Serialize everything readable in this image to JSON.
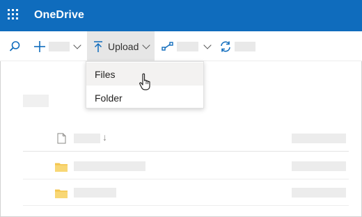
{
  "colors": {
    "brand": "#0f6cbd",
    "folder": "#f4c64e"
  },
  "header": {
    "app_title": "OneDrive"
  },
  "commandbar": {
    "upload_label": "Upload"
  },
  "upload_menu": {
    "items": [
      {
        "label": "Files"
      },
      {
        "label": "Folder"
      }
    ]
  },
  "file_list": {
    "sort_indicator": "↓"
  },
  "icons": [
    "app-launcher-icon",
    "search-icon",
    "plus-icon",
    "chevron-down-icon",
    "upload-icon",
    "share-icon",
    "sync-icon",
    "document-icon",
    "folder-icon",
    "hand-cursor-icon"
  ]
}
